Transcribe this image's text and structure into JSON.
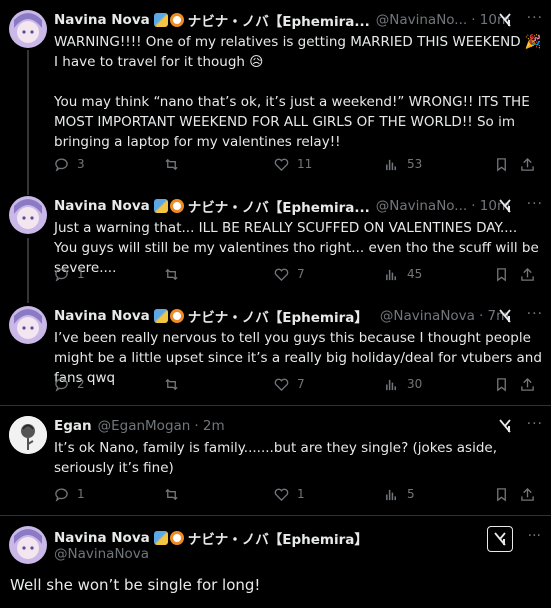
{
  "tweets": [
    {
      "name": "Navina Nova",
      "jp_name": "ナビナ・ノバ【Ephemira...",
      "handle": "@NavinaNo...",
      "time": "· 10m",
      "text": "WARNING!!!! One of my relatives is getting MARRIED THIS WEEKEND 🎉 I have to travel for it though 😥\n\nYou may think “nano that’s ok, it’s just a weekend!” WRONG!! ITS THE MOST IMPORTANT WEEKEND FOR ALL GIRLS OF THE WORLD!! So im bringing a laptop for my valentines relay!!",
      "replies": "3",
      "retweets": "",
      "likes": "11",
      "views": "53"
    },
    {
      "name": "Navina Nova",
      "jp_name": "ナビナ・ノバ【Ephemira...",
      "handle": "@NavinaNo...",
      "time": "· 10m",
      "text": "Just a warning that... ILL BE REALLY SCUFFED ON VALENTINES DAY.... You guys will still be my valentines tho right... even tho the scuff will be severe....",
      "replies": "1",
      "retweets": "",
      "likes": "7",
      "views": "45"
    },
    {
      "name": "Navina Nova",
      "jp_name": "ナビナ・ノバ【Ephemira】",
      "handle": "@NavinaNova",
      "time": "· 7m",
      "text": "I’ve been really nervous to tell you guys this because I thought people might be a little upset since it’s a really big holiday/deal for vtubers and fans qwq",
      "replies": "2",
      "retweets": "",
      "likes": "7",
      "views": "30"
    },
    {
      "name": "Egan",
      "jp_name": "",
      "handle": "@EganMogan",
      "time": "· 2m",
      "text": "It’s ok Nano, family is family.......but are they single? (jokes aside, seriously it’s fine)",
      "replies": "1",
      "retweets": "",
      "likes": "1",
      "views": "5"
    }
  ],
  "reply": {
    "name": "Navina Nova",
    "jp_name": "ナビナ・ノバ【Ephemira】",
    "handle": "@NavinaNova",
    "text": "Well she won’t be single for long!"
  },
  "icons": [
    "reply-icon",
    "retweet-icon",
    "like-icon",
    "views-icon",
    "bookmark-icon",
    "share-icon",
    "grok-icon",
    "more-icon"
  ],
  "colors": {
    "background": "#000000",
    "text": "#e7e9ea",
    "secondary": "#71767b",
    "divider": "#2f3336"
  }
}
